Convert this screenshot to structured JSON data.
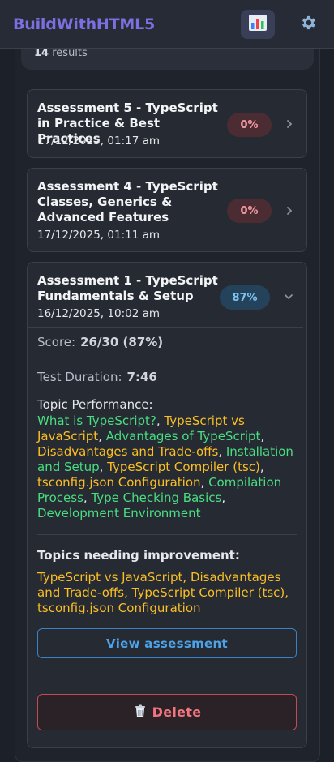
{
  "header": {
    "brand": "BuildWithHTML5",
    "chart_icon": "chart-icon",
    "settings_icon": "gear-icon"
  },
  "results": {
    "count": "14",
    "suffix": "results"
  },
  "assessments": [
    {
      "title": "Assessment 5 - TypeScript in Practice & Best Practices",
      "date": "17/12/2025, 01:17 am",
      "score_badge": "0%"
    },
    {
      "title": "Assessment 4 - TypeScript Classes, Generics & Advanced Features",
      "date": "17/12/2025, 01:11 am",
      "score_badge": "0%"
    },
    {
      "title": "Assessment 1 - TypeScript Fundamentals & Setup",
      "date": "16/12/2025, 10:02 am",
      "score_badge": "87%"
    }
  ],
  "detail": {
    "score_label": "Score:",
    "score_value": "26/30 (87%)",
    "duration_label": "Test Duration:",
    "duration_value": "7:46",
    "topic_performance_label": "Topic Performance:",
    "topics": [
      {
        "name": "What is TypeScript?",
        "status": "good"
      },
      {
        "name": "TypeScript vs JavaScript",
        "status": "weak"
      },
      {
        "name": "Advantages of TypeScript",
        "status": "good"
      },
      {
        "name": "Disadvantages and Trade-offs",
        "status": "weak"
      },
      {
        "name": "Installation and Setup",
        "status": "good"
      },
      {
        "name": "TypeScript Compiler (tsc)",
        "status": "weak"
      },
      {
        "name": "tsconfig.json Configuration",
        "status": "weak"
      },
      {
        "name": "Compilation Process",
        "status": "good"
      },
      {
        "name": "Type Checking Basics",
        "status": "good"
      },
      {
        "name": "Development Environment",
        "status": "good"
      }
    ],
    "improvement_label": "Topics needing improvement:",
    "improvement_topics": [
      "TypeScript vs JavaScript",
      "Disadvantages and Trade-offs",
      "TypeScript Compiler (tsc)",
      "tsconfig.json Configuration"
    ],
    "view_button": "View assessment",
    "delete_button": "Delete",
    "delete_icon": "trash-icon"
  },
  "colors": {
    "good": "#4ade80",
    "weak": "#fbbf24",
    "accent": "#7c6fe0"
  }
}
